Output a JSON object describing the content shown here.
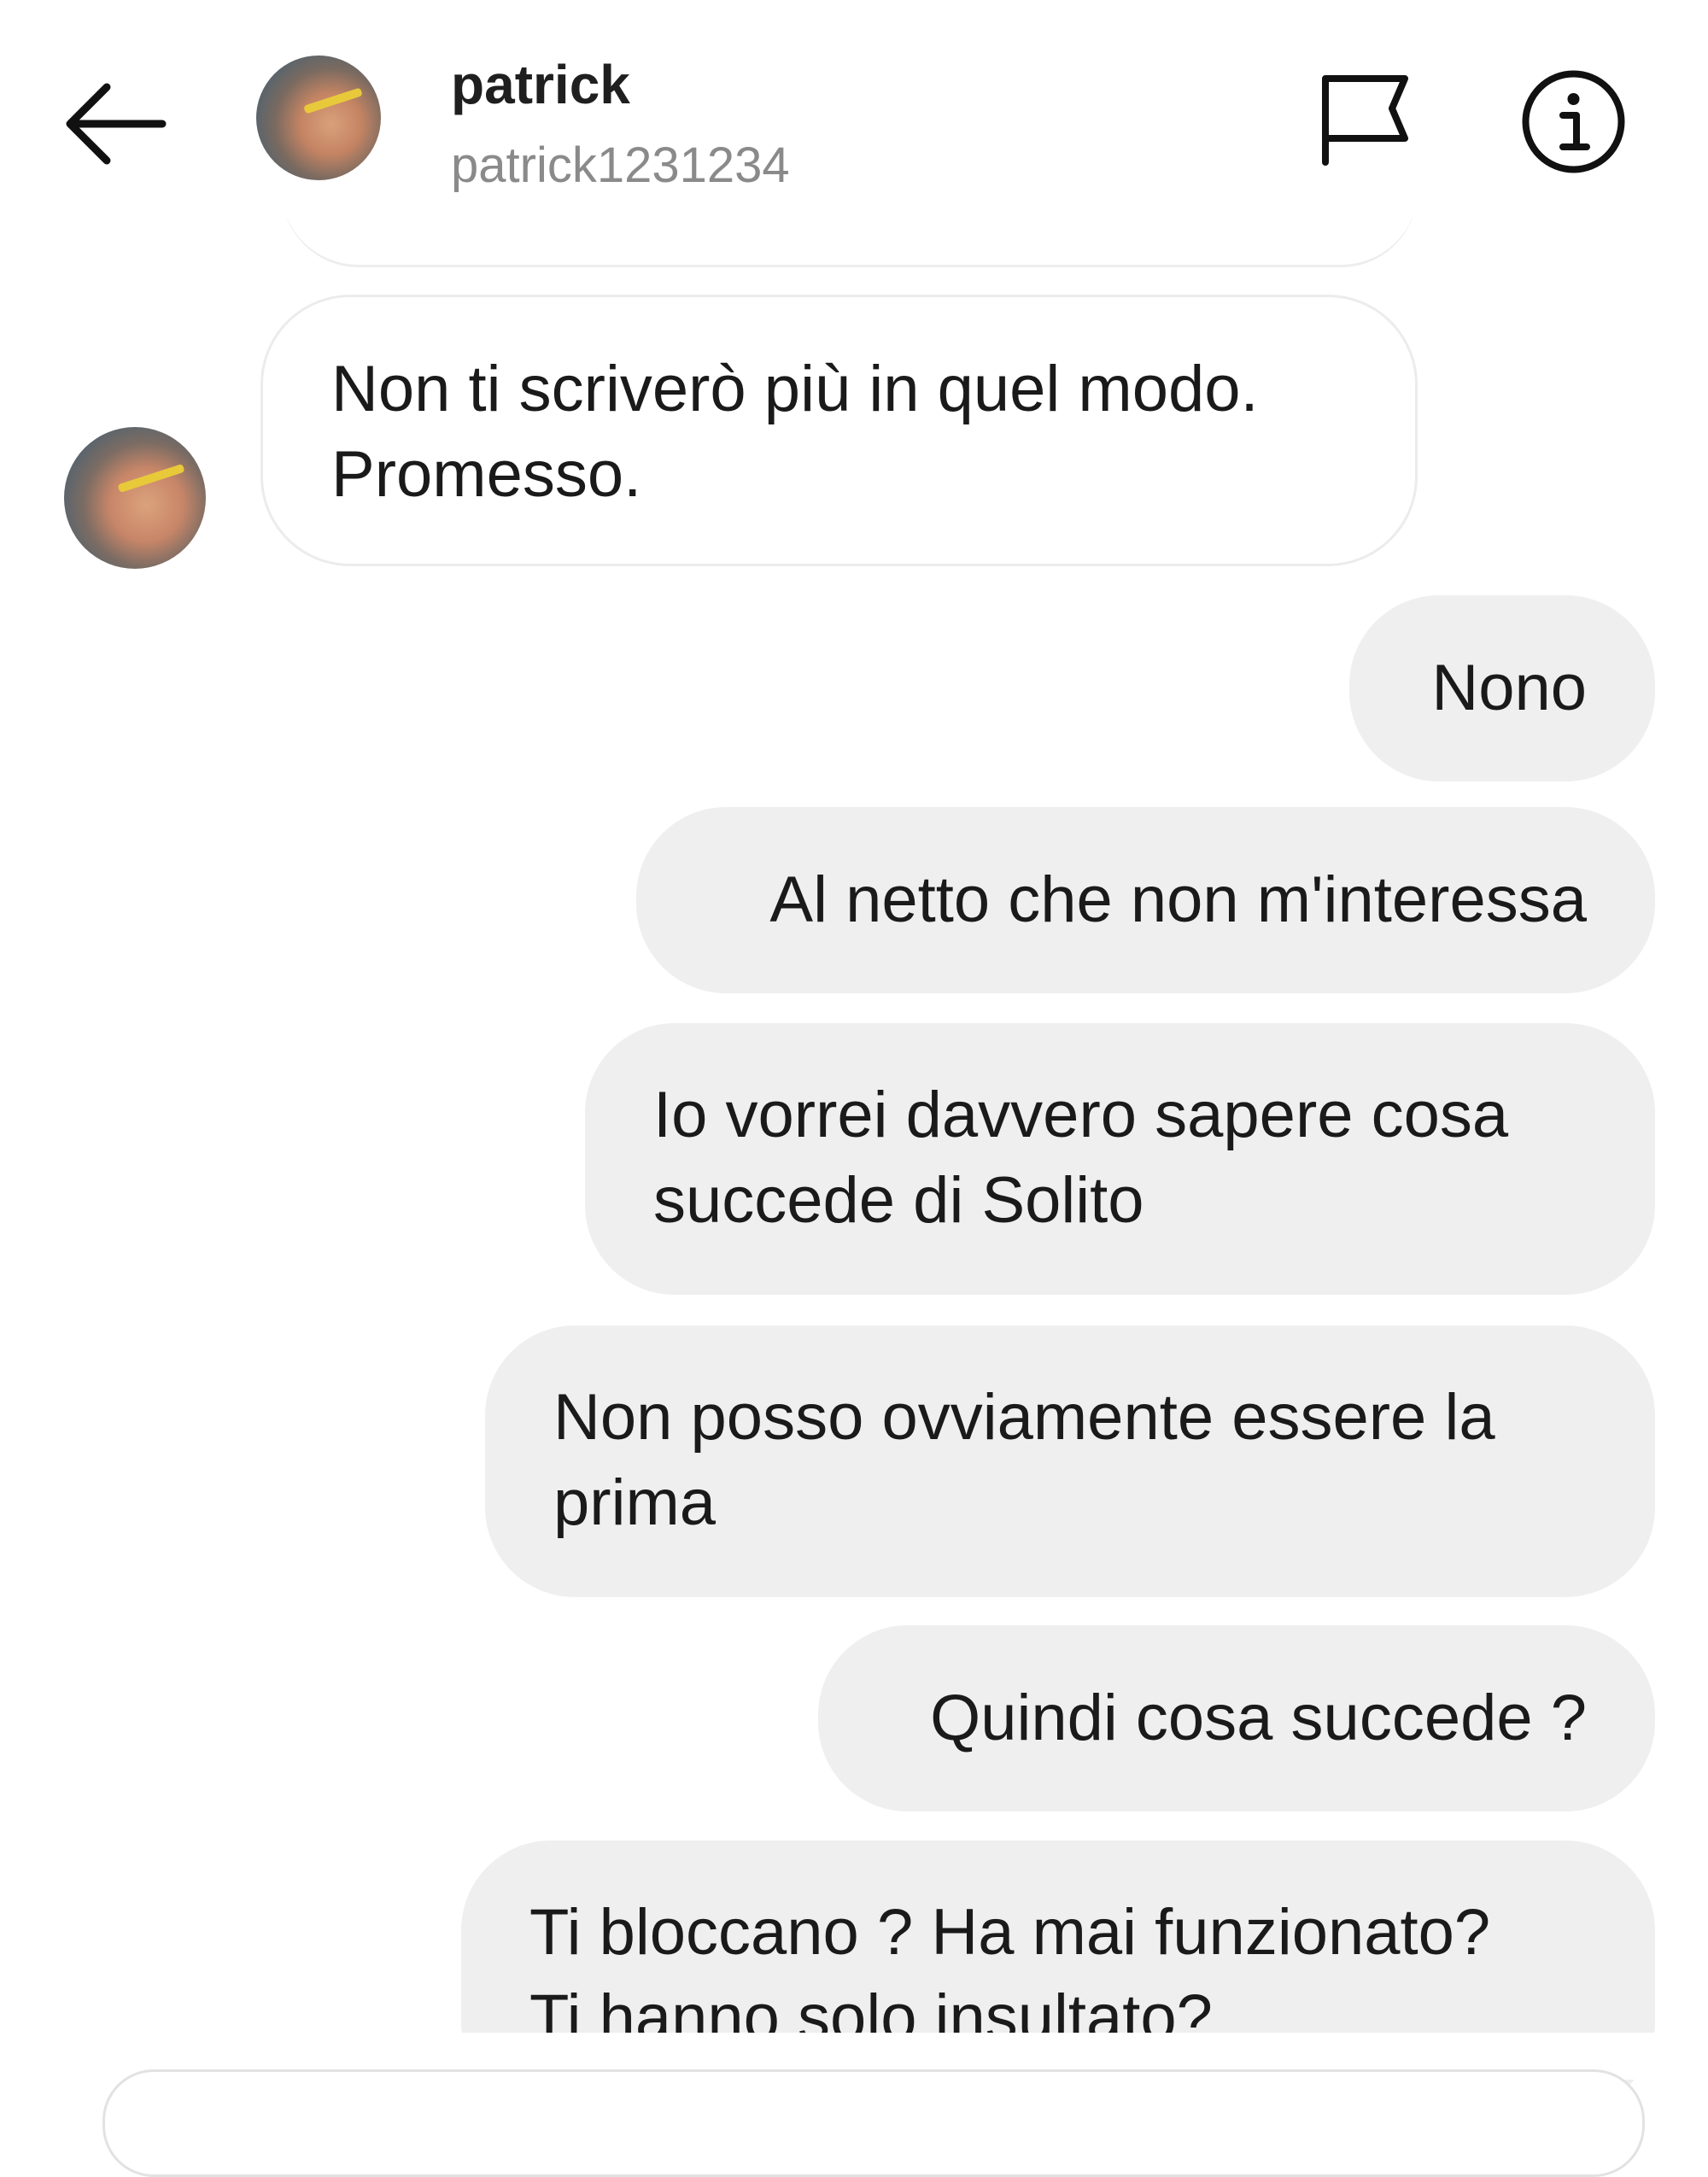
{
  "header": {
    "name": "patrick",
    "username": "patrick1231234"
  },
  "messages": [
    {
      "side": "incoming",
      "text": "Non ti scriverò più in quel modo.\nPromesso."
    },
    {
      "side": "outgoing",
      "text": "Nono"
    },
    {
      "side": "outgoing",
      "text": "Al netto che non m'interessa"
    },
    {
      "side": "outgoing",
      "text": "Io vorrei davvero sapere cosa\nsuccede di Solito"
    },
    {
      "side": "outgoing",
      "text": "Non posso ovviamente essere la\nprima"
    },
    {
      "side": "outgoing",
      "text": "Quindi cosa succede ?"
    },
    {
      "side": "outgoing",
      "text": "Ti bloccano ? Ha mai funzionato?\nTi hanno solo insultato?"
    }
  ],
  "icons": {
    "back": "arrow-left-icon",
    "report": "flag-icon",
    "info": "info-icon"
  }
}
